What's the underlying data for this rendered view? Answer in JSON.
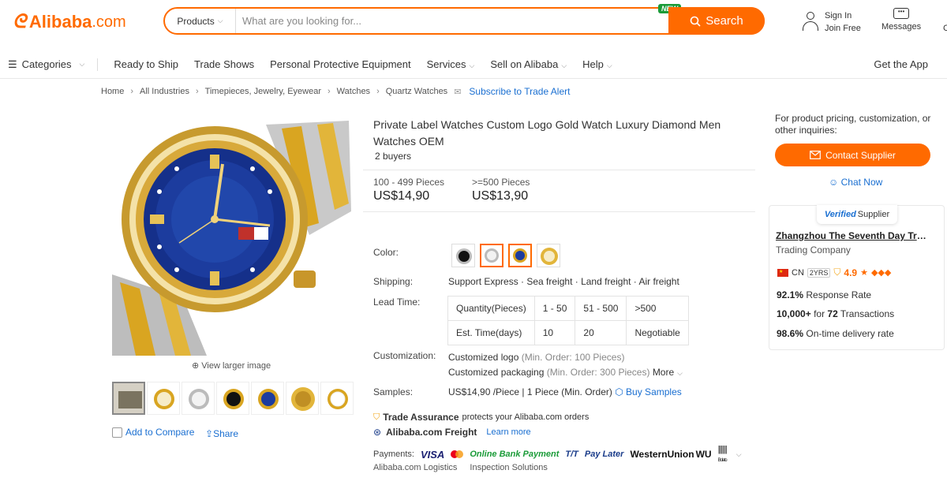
{
  "header": {
    "logo_text": "Alibaba",
    "logo_suffix": ".com",
    "search_category": "Products",
    "search_placeholder": "What are you looking for...",
    "new_badge": "NEW",
    "search_button": "Search",
    "sign_in": "Sign In",
    "join_free": "Join Free",
    "messages": "Messages",
    "cut_label": "C",
    "brand_color": "#ff6a00"
  },
  "nav": {
    "categories": "Categories",
    "items": [
      "Ready to Ship",
      "Trade Shows",
      "Personal Protective Equipment",
      "Services",
      "Sell on Alibaba",
      "Help"
    ],
    "get_app": "Get the App"
  },
  "breadcrumb": {
    "items": [
      "Home",
      "All Industries",
      "Timepieces, Jewelry, Eyewear",
      "Watches",
      "Quartz Watches"
    ],
    "subscribe": "Subscribe to Trade Alert"
  },
  "gallery": {
    "view_larger": "View larger image",
    "add_to_compare": "Add to Compare",
    "share": "Share"
  },
  "product": {
    "title": "Private Label Watches Custom Logo Gold Watch Luxury Diamond Men Watches OEM",
    "buyers": "2 buyers",
    "prices": [
      {
        "range": "100 - 499 Pieces",
        "price": "US$14,90"
      },
      {
        "range": ">=500 Pieces",
        "price": "US$13,90"
      }
    ],
    "color_label": "Color:",
    "shipping_label": "Shipping:",
    "shipping_value": "Support Express · Sea freight · Land freight · Air freight",
    "lead_time_label": "Lead Time:",
    "lead_time": {
      "row1": [
        "Quantity(Pieces)",
        "1 - 50",
        "51 - 500",
        ">500"
      ],
      "row2": [
        "Est. Time(days)",
        "10",
        "20",
        "Negotiable"
      ]
    },
    "customization_label": "Customization:",
    "customization": [
      {
        "name": "Customized logo",
        "min": "(Min. Order: 100 Pieces)"
      },
      {
        "name": "Customized packaging",
        "min": "(Min. Order: 300 Pieces)",
        "more": "More"
      }
    ],
    "samples_label": "Samples:",
    "samples_value": "US$14,90 /Piece  |  1 Piece (Min. Order)",
    "buy_samples": "Buy Samples",
    "trade_assurance": "Trade Assurance",
    "trade_assurance_desc": "protects your Alibaba.com orders",
    "freight": "Alibaba.com Freight",
    "learn_more": "Learn more",
    "payments_label": "Payments:",
    "payments": {
      "visa": "VISA",
      "obp": "Online Bank Payment",
      "tt": "T/T",
      "pay_later": "Pay Later",
      "wu": "WesternUnion",
      "wu_short": "WU",
      "boleto": "Boleto"
    },
    "logistics": "Alibaba.com Logistics",
    "inspection": "Inspection Solutions"
  },
  "supplier": {
    "inquiry_text": "For product pricing, customization, or other inquiries:",
    "contact_button": "Contact Supplier",
    "chat_now": "Chat Now",
    "verified": "Verified",
    "verified_suffix": "Supplier",
    "name": "Zhangzhou The Seventh Day Trading Co., Ltd.",
    "type": "Trading Company",
    "country": "CN",
    "years": "2YRS",
    "rating": "4.9",
    "stats": [
      {
        "value": "92.1%",
        "label": "Response Rate"
      },
      {
        "value": "10,000+",
        "label_pre": "for",
        "value2": "72",
        "label": "Transactions"
      },
      {
        "value": "98.6%",
        "label": "On-time delivery rate"
      }
    ]
  }
}
